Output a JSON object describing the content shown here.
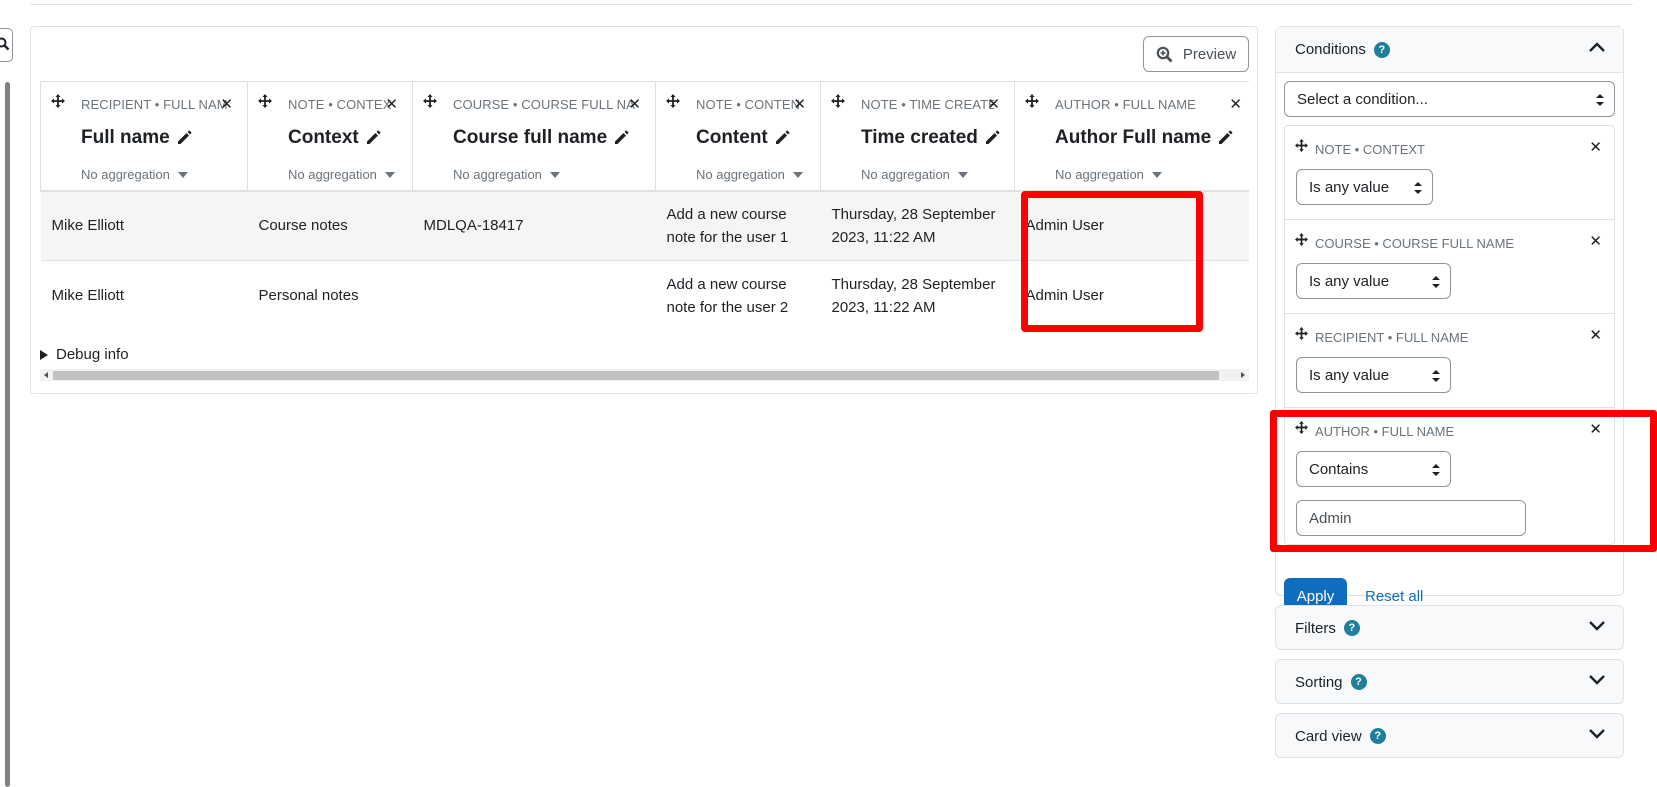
{
  "report": {
    "preview_label": "Preview",
    "columns": [
      {
        "category": "RECIPIENT • FULL NAME",
        "title": "Full name",
        "aggregation": "No aggregation"
      },
      {
        "category": "NOTE • CONTEXT",
        "title": "Context",
        "aggregation": "No aggregation"
      },
      {
        "category": "COURSE • COURSE FULL NAME",
        "title": "Course full name",
        "aggregation": "No aggregation"
      },
      {
        "category": "NOTE • CONTENT",
        "title": "Content",
        "aggregation": "No aggregation"
      },
      {
        "category": "NOTE • TIME CREATED",
        "title": "Time created",
        "aggregation": "No aggregation"
      },
      {
        "category": "AUTHOR • FULL NAME",
        "title": "Author Full name",
        "aggregation": "No aggregation"
      }
    ],
    "rows": [
      {
        "full_name": "Mike Elliott",
        "context": "Course notes",
        "course": "MDLQA-18417",
        "content": "Add a new course note for the user 1",
        "time": "Thursday, 28 September 2023, 11:22 AM",
        "author": "Admin User"
      },
      {
        "full_name": "Mike Elliott",
        "context": "Personal notes",
        "course": "",
        "content": "Add a new course note for the user 2",
        "time": "Thursday, 28 September 2023, 11:22 AM",
        "author": "Admin User"
      }
    ],
    "debug_label": "Debug info"
  },
  "conditions": {
    "title": "Conditions",
    "select_placeholder": "Select a condition...",
    "items": [
      {
        "label": "NOTE • CONTEXT",
        "operator": "Is any value"
      },
      {
        "label": "COURSE • COURSE FULL NAME",
        "operator": "Is any value"
      },
      {
        "label": "RECIPIENT • FULL NAME",
        "operator": "Is any value"
      },
      {
        "label": "AUTHOR • FULL NAME",
        "operator": "Contains",
        "value": "Admin"
      }
    ],
    "apply_label": "Apply",
    "reset_label": "Reset all"
  },
  "panels": {
    "filters": "Filters",
    "sorting": "Sorting",
    "card_view": "Card view"
  },
  "icons": {
    "help": "question-circle-icon",
    "move": "move-arrows-icon",
    "edit": "pencil-icon",
    "close": "close-icon",
    "search": "magnifier-icon"
  },
  "colors": {
    "primary": "#0f6cbf",
    "help": "#1f7e9a",
    "highlight": "#ff0000"
  }
}
